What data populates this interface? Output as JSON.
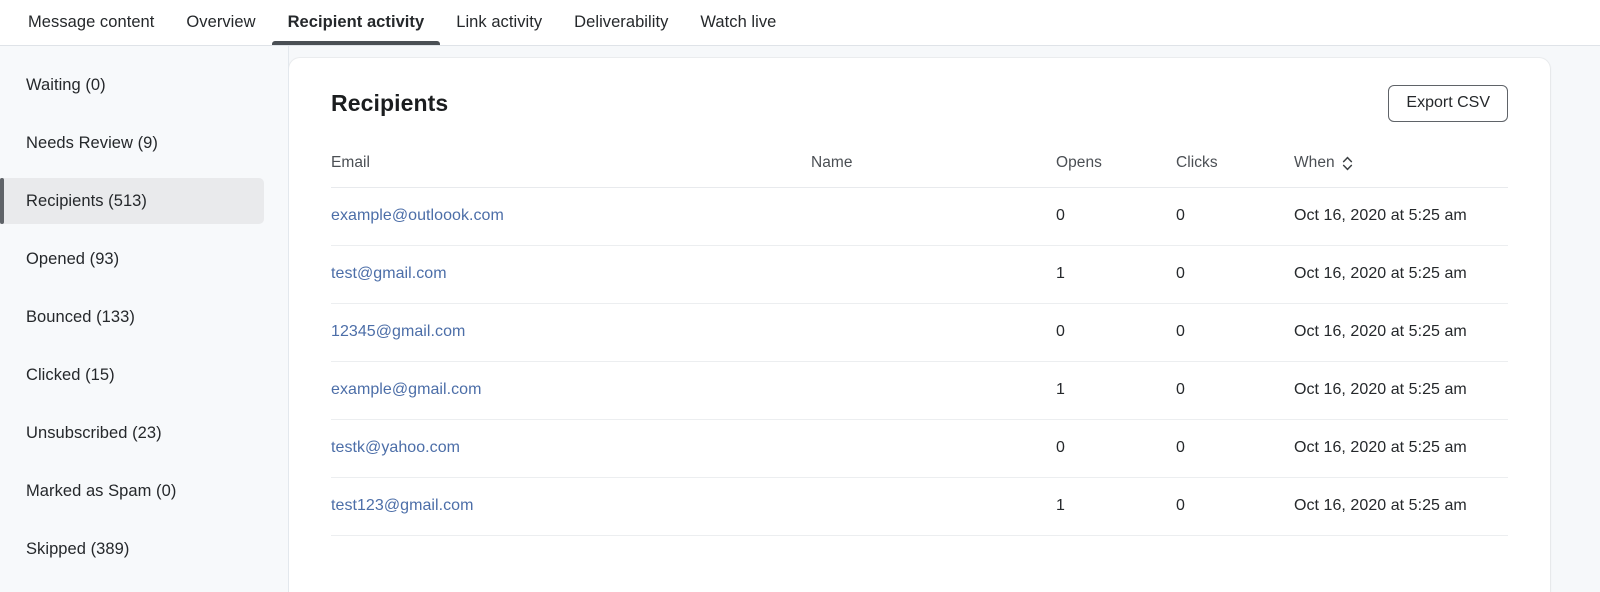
{
  "tabs": [
    {
      "label": "Message content",
      "active": false
    },
    {
      "label": "Overview",
      "active": false
    },
    {
      "label": "Recipient activity",
      "active": true
    },
    {
      "label": "Link activity",
      "active": false
    },
    {
      "label": "Deliverability",
      "active": false
    },
    {
      "label": "Watch live",
      "active": false
    }
  ],
  "sidebar": {
    "items": [
      {
        "label": "Waiting (0)",
        "selected": false
      },
      {
        "label": "Needs Review (9)",
        "selected": false
      },
      {
        "label": "Recipients (513)",
        "selected": true
      },
      {
        "label": "Opened (93)",
        "selected": false
      },
      {
        "label": "Bounced (133)",
        "selected": false
      },
      {
        "label": "Clicked (15)",
        "selected": false
      },
      {
        "label": "Unsubscribed (23)",
        "selected": false
      },
      {
        "label": "Marked as Spam (0)",
        "selected": false
      },
      {
        "label": "Skipped (389)",
        "selected": false
      }
    ]
  },
  "card": {
    "title": "Recipients",
    "export_label": "Export CSV"
  },
  "table": {
    "columns": [
      "Email",
      "Name",
      "Opens",
      "Clicks",
      "When"
    ],
    "sort_column": "When",
    "sort_icon": "sort-updown-icon",
    "rows": [
      {
        "email": "example@outloook.com",
        "name": "",
        "opens": "0",
        "clicks": "0",
        "when": "Oct 16, 2020 at 5:25 am"
      },
      {
        "email": "test@gmail.com",
        "name": "",
        "opens": "1",
        "clicks": "0",
        "when": "Oct 16, 2020 at 5:25 am"
      },
      {
        "email": "12345@gmail.com",
        "name": "",
        "opens": "0",
        "clicks": "0",
        "when": "Oct 16, 2020 at 5:25 am"
      },
      {
        "email": "example@gmail.com",
        "name": "",
        "opens": "1",
        "clicks": "0",
        "when": "Oct 16, 2020 at 5:25 am"
      },
      {
        "email": "testk@yahoo.com",
        "name": "",
        "opens": "0",
        "clicks": "0",
        "when": "Oct 16, 2020 at 5:25 am"
      },
      {
        "email": "test123@gmail.com",
        "name": "",
        "opens": "1",
        "clicks": "0",
        "when": "Oct 16, 2020 at 5:25 am"
      }
    ]
  },
  "colors": {
    "link": "#4c6ea8",
    "accent": "#4a4f54",
    "page_bg": "#f6f8fa",
    "selected_bg": "#e9eaec"
  }
}
